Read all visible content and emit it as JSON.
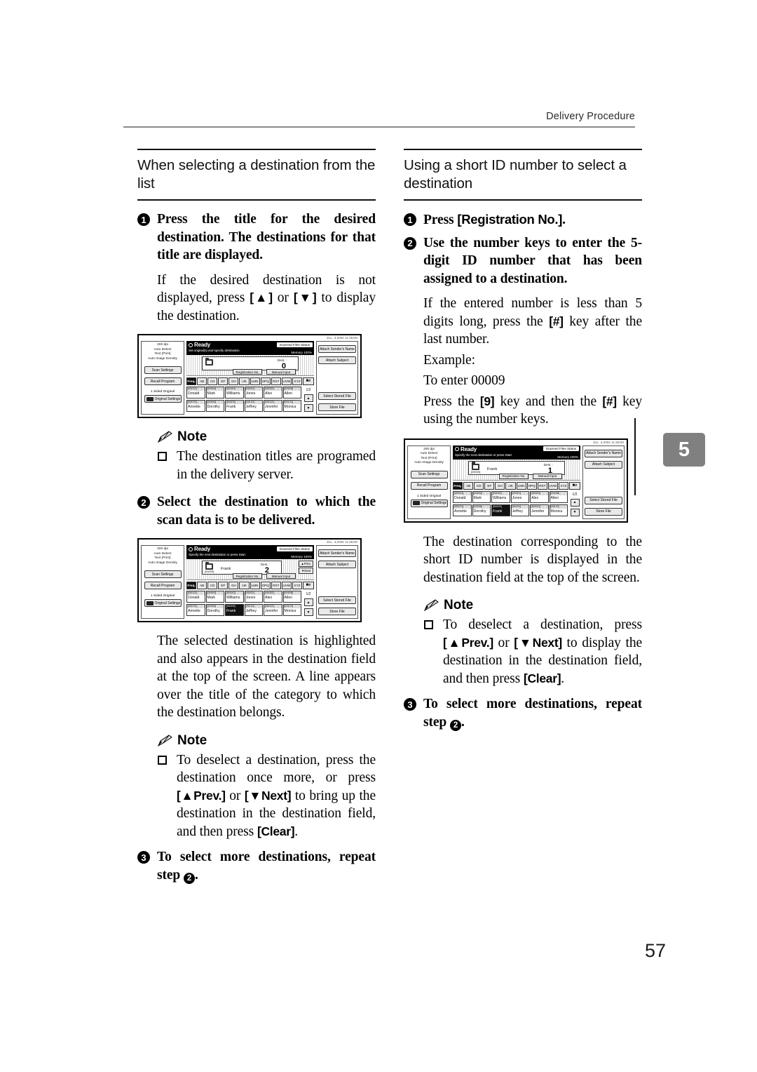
{
  "running_head": "Delivery Procedure",
  "chapter_tab": "5",
  "page_number": "57",
  "left_column": {
    "section_title": "When selecting a destination from the list",
    "step1_num": "1",
    "step1_text": "Press the title for the desired destination. The destinations for that title are displayed.",
    "step1_para_a": "If the desired destination is not displayed, press ",
    "step1_key_up": "[▲]",
    "step1_para_b": " or ",
    "step1_key_down": "[▼]",
    "step1_para_c": " to display the destination.",
    "note1_label": "Note",
    "note1_item": "The destination titles are programed in the delivery server.",
    "step2_num": "2",
    "step2_text": "Select the destination to which the scan data is to be delivered.",
    "para_selected": "The selected destination is highlighted and also appears in the destination field at the top of the screen. A line appears over the title of the category to which the destination belongs.",
    "note2_label": "Note",
    "note2_a": "To deselect a destination, press the destination once more, or press ",
    "note2_key_prev": "[▲Prev.]",
    "note2_b": " or ",
    "note2_key_next": "[▼Next]",
    "note2_c": " to bring up the destination in the destination field, and then press ",
    "note2_key_clear": "[Clear]",
    "note2_d": ".",
    "step3_num": "3",
    "step3_text_a": "To select more destinations, repeat step ",
    "step3_ref": "2",
    "step3_text_b": "."
  },
  "right_column": {
    "section_title": "Using a short ID number to select a destination",
    "step1_num": "1",
    "step1_a": "Press ",
    "step1_key": "[Registration No.]",
    "step1_b": ".",
    "step2_num": "2",
    "step2_text": "Use the number keys to enter the 5-digit ID number that has been assigned to a destination.",
    "para_less_a": "If the entered number is less than 5 digits long, press the ",
    "para_less_key": "[#]",
    "para_less_b": " key after the last number.",
    "example_label": "Example:",
    "example_enter": "To enter 00009",
    "example_press_a": "Press the ",
    "example_key9": "[9]",
    "example_press_b": " key and then the ",
    "example_keyhash": "[#]",
    "example_press_c": " key using the number keys.",
    "para_corresponding": "The destination corresponding to the short ID number is displayed in the destination field at the top of the screen.",
    "note_label": "Note",
    "note_a": "To deselect a destination, press ",
    "note_key_prev": "[▲Prev.]",
    "note_b": " or ",
    "note_key_next": "[▼Next]",
    "note_c": " to display the destination in the destination field, and then press ",
    "note_key_clear": "[Clear]",
    "note_d": ".",
    "step3_num": "3",
    "step3_text_a": "To select more destinations, repeat step ",
    "step3_ref": "2",
    "step3_text_b": "."
  },
  "lcd_common": {
    "date": "JUL.  3,2002 11:35AM",
    "left_info": [
      "200 dpi",
      "Auto Detect",
      "Text (Print)",
      "Auto Image Density"
    ],
    "btn_scan_settings": "Scan Settings",
    "btn_recall_program": "Recall Program",
    "label_1sided": "1 Sided Original",
    "btn_original_settings": "Original Settings",
    "btn_attach_sender": "Attach Sender's Name",
    "btn_attach_subject": "Attach Subject",
    "btn_select_stored": "Select Stored File",
    "btn_store_file": "Store File",
    "status_ready": "Ready",
    "btn_scanned_status": "Scanned Files Status",
    "memory": "Memory 100%",
    "dest_label": "Dest. :",
    "btn_registration_no": "Registration No.",
    "btn_manual_input": "Manual Input",
    "btn_prev": "▲Prev.",
    "btn_next": "▼Next",
    "search_icon": "search-icon",
    "tabs": [
      "Freq.",
      "AB",
      "CD",
      "EF",
      "GH",
      "IJK",
      "LMN",
      "OPQ",
      "RST",
      "UVW",
      "XYZ"
    ],
    "page_count": "1/2",
    "arrow_up": "▲",
    "arrow_down": "▼",
    "row1": [
      {
        "id": "[00013]",
        "name": "Donald"
      },
      {
        "id": "[00004]",
        "name": "Mark"
      },
      {
        "id": "[00043]",
        "name": "Williams"
      },
      {
        "id": "[00021]",
        "name": "Jones"
      },
      {
        "id": "[00053]",
        "name": "Alex"
      },
      {
        "id": "[00008]",
        "name": "Allen"
      }
    ],
    "row2": [
      {
        "id": "[00073]",
        "name": "Annette"
      },
      {
        "id": "[00006]",
        "name": "Dorothy"
      },
      {
        "id": "[00009]",
        "name": "Frank"
      },
      {
        "id": "[00101]",
        "name": "Jeffrey"
      },
      {
        "id": "[00013]",
        "name": "Jennifer"
      },
      {
        "id": "[00121]",
        "name": "Monica"
      }
    ]
  },
  "lcd1": {
    "sub_message": "Set original(s) and specify destination.",
    "dest_count": "0",
    "dest_id": "",
    "dest_name": "",
    "selected_tab": "Freq.",
    "selected_name": ""
  },
  "lcd2": {
    "sub_message": "Specify the next destination or press Start.",
    "dest_count": "2",
    "dest_id": "[00009]",
    "dest_name": "Frank",
    "selected_tab": "Freq.",
    "selected_name": "Frank"
  },
  "lcd3": {
    "sub_message": "Specify the next destination or press Start.",
    "dest_count": "1",
    "dest_id": "[00009]",
    "dest_name": "Frank",
    "selected_tab": "Freq.",
    "selected_name": "Frank"
  }
}
